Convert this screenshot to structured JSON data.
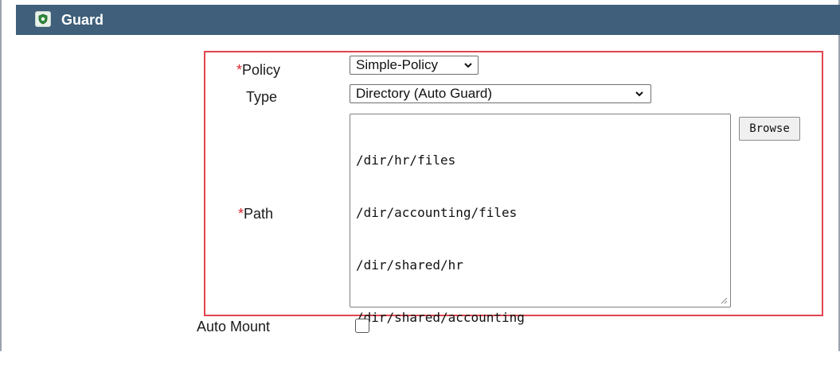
{
  "header": {
    "title": "Guard",
    "icon": "shield-icon",
    "background": "#3f5f7a"
  },
  "form": {
    "policy": {
      "required_mark": "*",
      "label": "Policy",
      "selected": "Simple-Policy"
    },
    "type": {
      "label": "Type",
      "selected": "Directory (Auto Guard)"
    },
    "path": {
      "required_mark": "*",
      "label": "Path",
      "lines": [
        "/dir/hr/files",
        "/dir/accounting/files",
        "/dir/shared/hr",
        "/dir/shared/accounting"
      ],
      "browse_label": "Browse"
    },
    "auto_mount": {
      "label": "Auto Mount",
      "checked": false
    }
  },
  "colors": {
    "highlight_border": "#e0454f",
    "required_mark": "#d8232a"
  }
}
